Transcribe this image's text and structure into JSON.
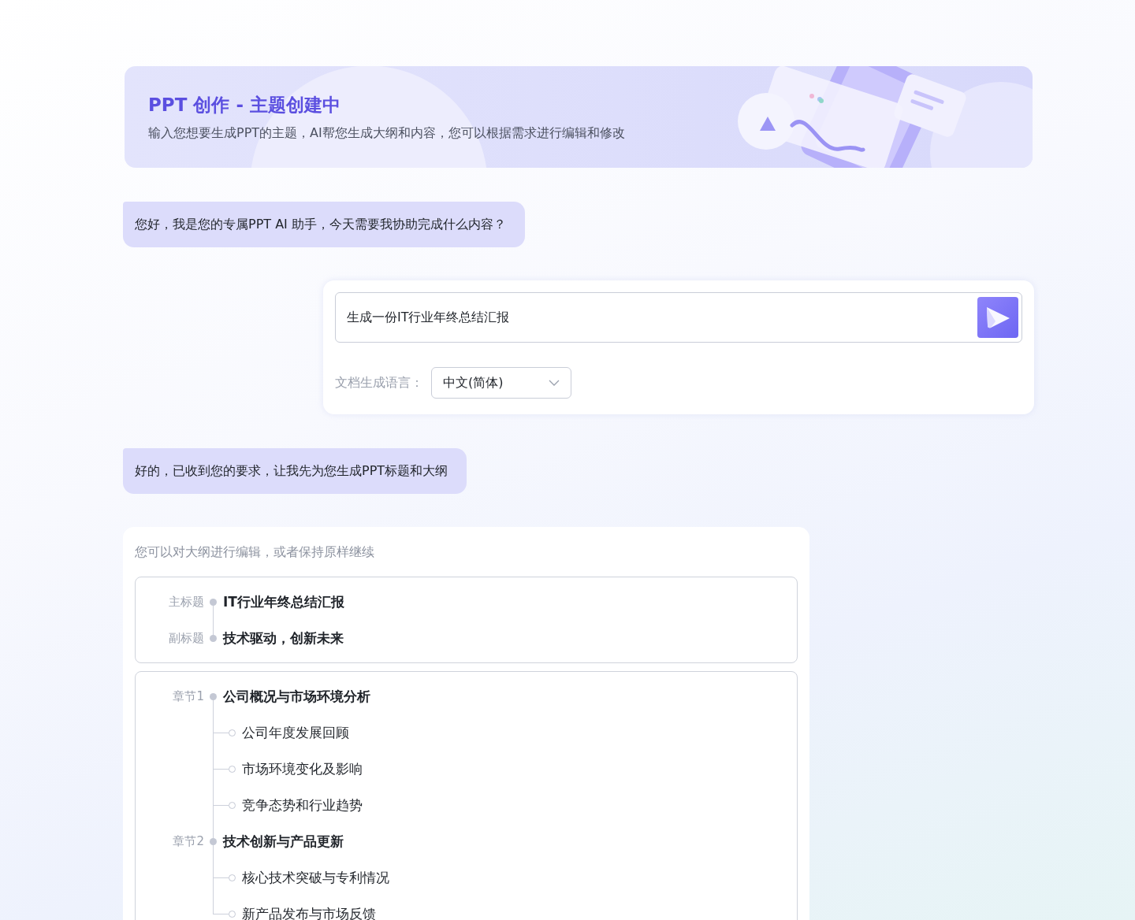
{
  "banner": {
    "title": "PPT 创作 - 主题创建中",
    "subtitle": "输入您想要生成PPT的主题，AI帮您生成大纲和内容，您可以根据需求进行编辑和修改"
  },
  "conversation": [
    {
      "kind": "assistant_message",
      "text": "您好，我是您的专属PPT AI 助手，今天需要我协助完成什么内容？"
    },
    {
      "kind": "prompt_form",
      "value": "生成一份IT行业年终总结汇报",
      "language_label": "文档生成语言：",
      "language_value": "中文(简体)"
    },
    {
      "kind": "assistant_message",
      "text": "好的，已收到您的要求，让我先为您生成PPT标题和大纲"
    },
    {
      "kind": "outline",
      "hint": "您可以对大纲进行编辑，或者保持原样继续",
      "titles": [
        {
          "label": "主标题",
          "text": "IT行业年终总结汇报"
        },
        {
          "label": "副标题",
          "text": "技术驱动，创新未来"
        }
      ],
      "chapters": [
        {
          "label": "章节1",
          "title": "公司概况与市场环境分析",
          "children": [
            {
              "text": "公司年度发展回顾"
            },
            {
              "text": "市场环境变化及影响"
            },
            {
              "text": "竞争态势和行业趋势"
            }
          ]
        },
        {
          "label": "章节2",
          "title": "技术创新与产品更新",
          "children": [
            {
              "text": "核心技术突破与专利情况"
            },
            {
              "text": "新产品发布与市场反馈"
            }
          ]
        }
      ]
    }
  ]
}
